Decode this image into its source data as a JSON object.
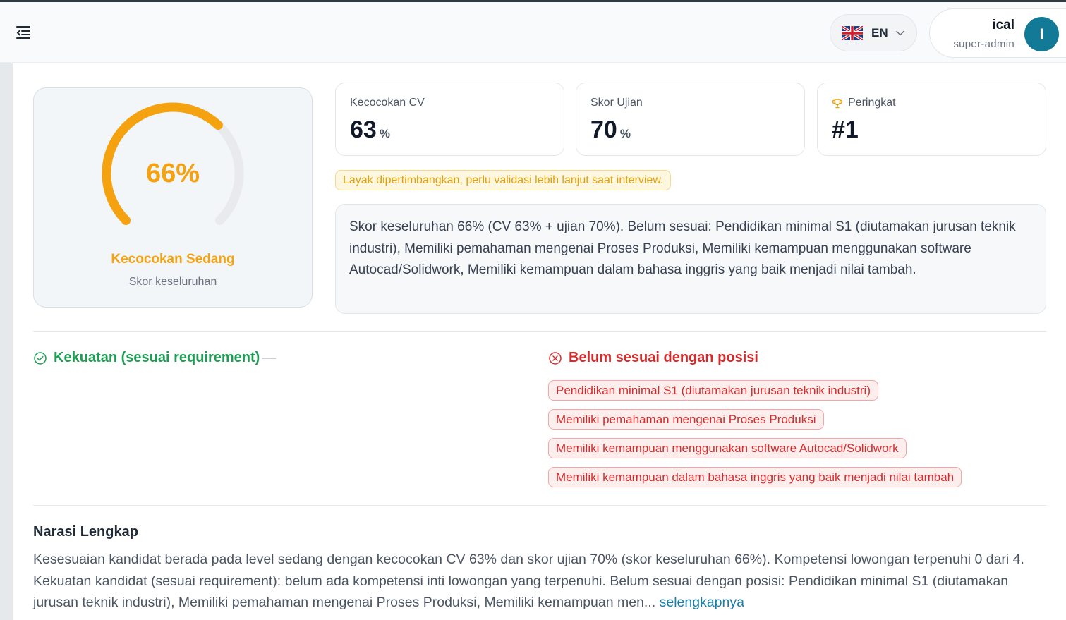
{
  "header": {
    "menu_icon": "menu-collapse-icon",
    "language": {
      "code": "EN",
      "flag": "uk-flag-icon"
    },
    "user": {
      "name": "ical",
      "role": "super-admin",
      "avatar_initial": "I",
      "avatar_color": "#127a96"
    }
  },
  "gauge": {
    "value_text": "66%",
    "value": 66,
    "level_label": "Kecocokan Sedang",
    "caption": "Skor keseluruhan",
    "color": "#f5a211"
  },
  "stats": {
    "cv": {
      "label": "Kecocokan CV",
      "value": "63",
      "unit": "%"
    },
    "exam": {
      "label": "Skor Ujian",
      "value": "70",
      "unit": "%"
    },
    "rank": {
      "label": "Peringkat",
      "value": "#1",
      "icon": "trophy-icon"
    }
  },
  "recommendation": "Layak dipertimbangkan, perlu validasi lebih lanjut saat interview.",
  "summary": "Skor keseluruhan 66% (CV 63% + ujian 70%). Belum sesuai: Pendidikan minimal S1 (diutamakan jurusan teknik industri), Memiliki pemahaman mengenai Proses Produksi, Memiliki kemampuan menggunakan software Autocad/Solidwork, Memiliki kemampuan dalam bahasa inggris yang baik menjadi nilai tambah.",
  "strengths": {
    "title": "Kekuatan (sesuai requirement)",
    "empty": "—",
    "items": []
  },
  "gaps": {
    "title": "Belum sesuai dengan posisi",
    "items": [
      "Pendidikan minimal S1 (diutamakan jurusan teknik industri)",
      "Memiliki pemahaman mengenai Proses Produksi",
      "Memiliki kemampuan menggunakan software Autocad/Solidwork",
      "Memiliki kemampuan dalam bahasa inggris yang baik menjadi nilai tambah"
    ]
  },
  "narrative": {
    "title": "Narasi Lengkap",
    "text": "Kesesuaian kandidat berada pada level sedang dengan kecocokan CV 63% dan skor ujian 70% (skor keseluruhan 66%). Kompetensi lowongan terpenuhi 0 dari 4. Kekuatan kandidat (sesuai requirement): belum ada kompetensi inti lowongan yang terpenuhi. Belum sesuai dengan posisi: Pendidikan minimal S1 (diutamakan jurusan teknik industri), Memiliki pemahaman mengenai Proses Produksi, Memiliki kemampuan men...",
    "more_label": "selengkapnya"
  }
}
